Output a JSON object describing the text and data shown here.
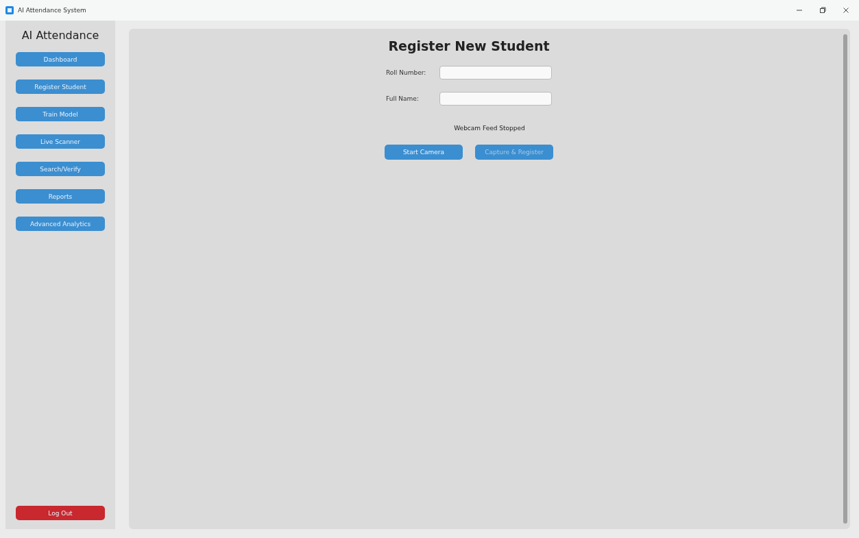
{
  "window": {
    "title": "AI Attendance System"
  },
  "sidebar": {
    "title": "AI Attendance",
    "items": [
      {
        "label": "Dashboard"
      },
      {
        "label": "Register Student"
      },
      {
        "label": "Train Model"
      },
      {
        "label": "Live Scanner"
      },
      {
        "label": "Search/Verify"
      },
      {
        "label": "Reports"
      },
      {
        "label": "Advanced Analytics"
      }
    ],
    "logout": {
      "label": "Log Out"
    }
  },
  "form": {
    "title": "Register New Student",
    "fields": [
      {
        "label": "Roll Number:"
      },
      {
        "label": "Full Name:"
      }
    ],
    "status": "Webcam Feed Stopped",
    "buttons": [
      {
        "label": "Start Camera",
        "disabled": false
      },
      {
        "label": "Capture & Register",
        "disabled": true
      }
    ]
  }
}
